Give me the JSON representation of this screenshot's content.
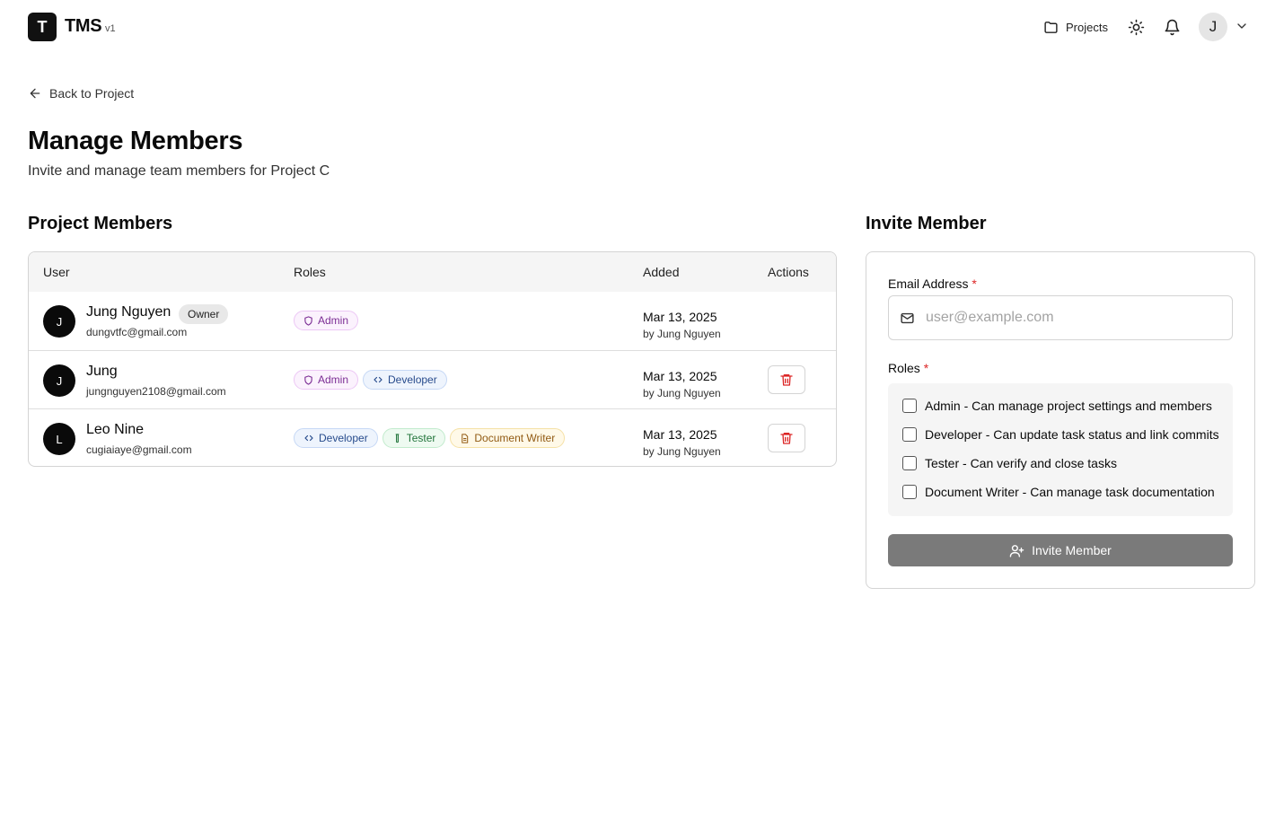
{
  "header": {
    "logo_letter": "T",
    "app_name": "TMS",
    "app_version": "v1",
    "projects_label": "Projects",
    "user_initial": "J"
  },
  "back_link": "Back to Project",
  "page": {
    "title": "Manage Members",
    "subtitle": "Invite and manage team members for Project C"
  },
  "members_section": {
    "title": "Project Members",
    "columns": [
      "User",
      "Roles",
      "Added",
      "Actions"
    ],
    "rows": [
      {
        "initial": "J",
        "name": "Jung Nguyen",
        "badge": "Owner",
        "email": "dungvtfc@gmail.com",
        "roles": [
          "Admin"
        ],
        "added_date": "Mar 13, 2025",
        "added_by": "by Jung Nguyen"
      },
      {
        "initial": "J",
        "name": "Jung",
        "email": "jungnguyen2108@gmail.com",
        "roles": [
          "Admin",
          "Developer"
        ],
        "added_date": "Mar 13, 2025",
        "added_by": "by Jung Nguyen"
      },
      {
        "initial": "L",
        "name": "Leo Nine",
        "email": "cugiaiaye@gmail.com",
        "roles": [
          "Developer",
          "Tester",
          "Document Writer"
        ],
        "added_date": "Mar 13, 2025",
        "added_by": "by Jung Nguyen"
      }
    ]
  },
  "invite": {
    "title": "Invite Member",
    "email_label": "Email Address",
    "required_mark": "*",
    "email_placeholder": "user@example.com",
    "email_value": "",
    "roles_label": "Roles",
    "role_options": [
      "Admin - Can manage project settings and members",
      "Developer - Can update task status and link commits",
      "Tester - Can verify and close tasks",
      "Document Writer - Can manage task documentation"
    ],
    "button_label": "Invite Member"
  },
  "colors": {
    "primary": "#0a0a0a",
    "danger": "#dc2626",
    "button_disabled": "#7a7a7a",
    "admin": "#7b2d94",
    "developer": "#274b8c",
    "tester": "#23753c",
    "document_writer": "#915a13"
  }
}
